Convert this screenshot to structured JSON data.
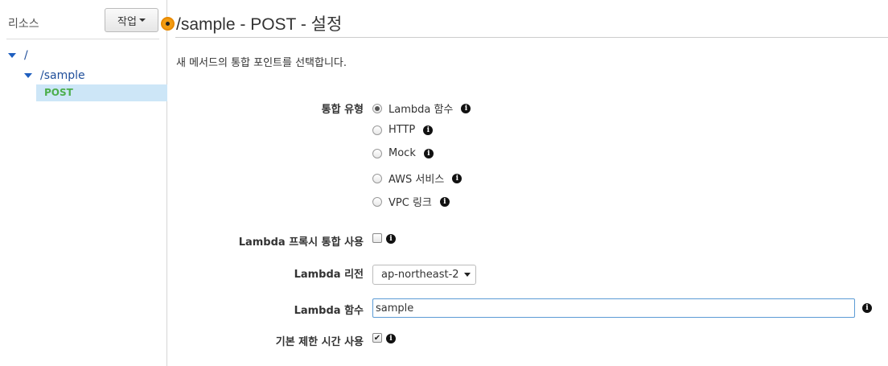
{
  "sidebar": {
    "title": "리소스",
    "actions_label": "작업",
    "tree": {
      "root": "/",
      "child": "/sample",
      "method": "POST"
    }
  },
  "main": {
    "title": "/sample - POST - 설정",
    "description": "새 메서드의 통합 포인트를 선택합니다.",
    "integration_type": {
      "label": "통합 유형",
      "options": [
        "Lambda 함수",
        "HTTP",
        "Mock",
        "AWS 서비스",
        "VPC 링크"
      ],
      "selected": "Lambda 함수"
    },
    "proxy": {
      "label": "Lambda 프록시 통합 사용",
      "checked": false
    },
    "region": {
      "label": "Lambda 리전",
      "value": "ap-northeast-2"
    },
    "function": {
      "label": "Lambda 함수",
      "value": "sample"
    },
    "timeout": {
      "label": "기본 제한 시간 사용",
      "checked": true
    }
  },
  "colors": {
    "handle": "#f39c12",
    "selected_bg": "#cde6f7",
    "post_text": "#4cae4c",
    "link": "#1f4e9a"
  }
}
